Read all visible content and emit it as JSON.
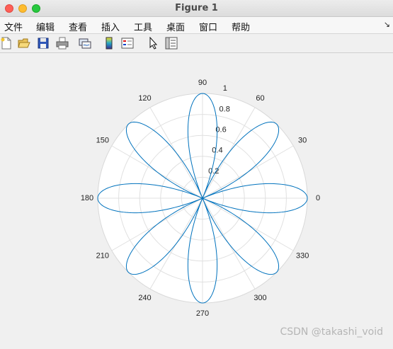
{
  "window": {
    "title": "Figure 1"
  },
  "menu": {
    "items": [
      "文件",
      "编辑",
      "查看",
      "插入",
      "工具",
      "桌面",
      "窗口",
      "帮助"
    ]
  },
  "toolbar": {
    "buttons": [
      "new-figure-icon",
      "open-file-icon",
      "save-icon",
      "print-icon",
      "link-plot-icon",
      "colorbar-icon",
      "legend-icon",
      "pointer-icon",
      "property-inspector-icon"
    ]
  },
  "chart_data": {
    "type": "line",
    "subtype": "polar",
    "function": "r = |cos(4*theta)|",
    "theta_ticks": [
      "0",
      "30",
      "60",
      "90",
      "120",
      "150",
      "180",
      "210",
      "240",
      "270",
      "300",
      "330"
    ],
    "r_ticks": [
      "0.2",
      "0.4",
      "0.6",
      "0.8",
      "1"
    ],
    "rlim": [
      0,
      1
    ],
    "series": [
      {
        "color": "#0072bd",
        "petals": 8,
        "max_r": 1
      }
    ],
    "grid": true
  },
  "watermark": "CSDN @takashi_void"
}
